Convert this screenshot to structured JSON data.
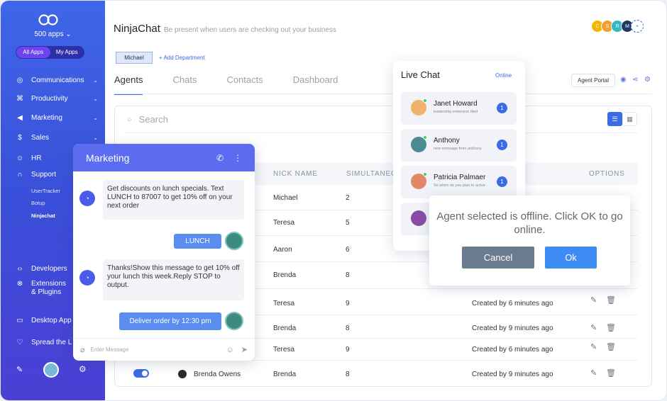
{
  "sidebar": {
    "apps_count": "500 apps",
    "toggle": [
      "All Apps",
      "My Apps"
    ],
    "items": [
      {
        "label": "Communications",
        "icon": "globe-icon"
      },
      {
        "label": "Productivity",
        "icon": "command-icon"
      },
      {
        "label": "Marketing",
        "icon": "megaphone-icon"
      },
      {
        "label": "Sales",
        "icon": "dollar-icon"
      },
      {
        "label": "HR",
        "icon": "person-icon"
      },
      {
        "label": "Support",
        "icon": "headset-icon"
      }
    ],
    "support_sub": [
      "UserTracker",
      "Botup",
      "Ninjachat"
    ],
    "items2": [
      {
        "label": "Developers",
        "icon": "code-icon"
      },
      {
        "label": "Extensions & Plugins",
        "icon": "puzzle-icon"
      },
      {
        "label": "Desktop App",
        "icon": "monitor-icon"
      },
      {
        "label": "Spread the L",
        "icon": "heart-icon"
      }
    ]
  },
  "header": {
    "title": "NinjaChat",
    "subtitle": "Be present when users are checking out your business",
    "avatars": [
      "C",
      "S",
      "R",
      "M"
    ]
  },
  "department": {
    "tag": "Michael",
    "add": "+ Add Department"
  },
  "tabs": [
    "Agents",
    "Chats",
    "Contacts",
    "Dashboard"
  ],
  "toolbar": {
    "agent_portal": "Agent Portal"
  },
  "search": {
    "placeholder": "Search"
  },
  "table": {
    "headers": {
      "nick": "NICK NAME",
      "sim": "SIMULTANEO",
      "options": "OPTIONS"
    },
    "rows": [
      {
        "nick": "Michael",
        "sim": "2",
        "created": ""
      },
      {
        "nick": "Teresa",
        "sim": "5",
        "created": ""
      },
      {
        "nick": "Aaron",
        "sim": "6",
        "created": ""
      },
      {
        "nick": "Brenda",
        "sim": "8",
        "created": ""
      },
      {
        "nick": "Teresa",
        "sim": "9",
        "created": "Created by 6 minutes ago"
      },
      {
        "nick": "Brenda",
        "sim": "8",
        "created": "Created by 9 minutes ago"
      },
      {
        "nick": "Teresa",
        "sim": "9",
        "created": "Created by 6 minutes ago"
      },
      {
        "nick": "Brenda",
        "sim": "8",
        "created": "Created by 9 minutes ago",
        "name": "Brenda Owens"
      }
    ]
  },
  "chat": {
    "title": "Marketing",
    "msg1": "Get discounts on lunch specials. Text LUNCH to 87007 to get 10% off on your next order",
    "reply1": "LUNCH",
    "msg2": "Thanks!Show this message to get 10% off your lunch this week.Reply STOP to output.",
    "reply2": "Deliver order by 12:30 pm",
    "input_placeholder": "Enter Message"
  },
  "live_chat": {
    "title": "Live Chat",
    "status": "Online",
    "items": [
      {
        "name": "Janet Howard",
        "msg": "leadership extension filed",
        "count": "1"
      },
      {
        "name": "Anthony",
        "msg": "new message from anthony",
        "count": "1"
      },
      {
        "name": "Patricia Palmaer",
        "msg": "So when do you plan to arrive",
        "count": "1"
      }
    ]
  },
  "dialog": {
    "text": "Agent selected is offline. Click OK to go online.",
    "cancel": "Cancel",
    "ok": "Ok"
  },
  "colors": {
    "accent": "#3b6be6",
    "sidebar": "#3f56e0",
    "chat_header": "#5b6cf0"
  }
}
